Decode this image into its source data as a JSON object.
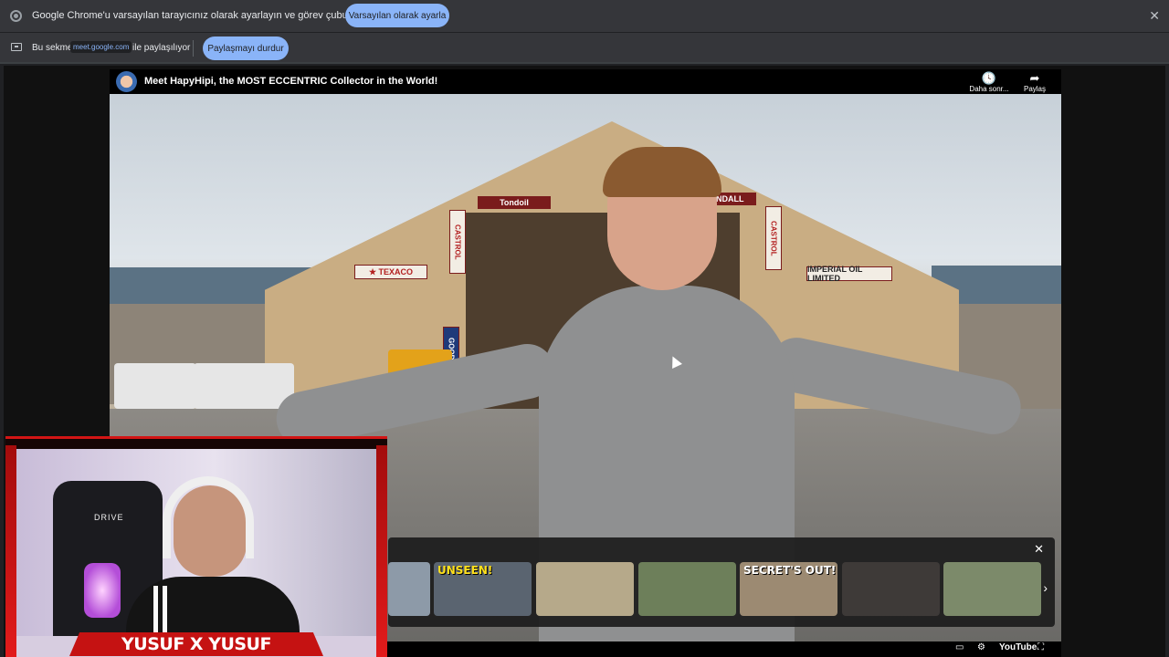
{
  "infobar": {
    "message": "Google Chrome'u varsayılan tarayıcınız olarak ayarlayın ve görev çubuğunuza sabitleyin",
    "default_button": "Varsayılan olarak ayarla",
    "close": "✕"
  },
  "sharebar": {
    "prefix": "Bu sekme",
    "host": "meet.google.com",
    "suffix": "ile paylaşılıyor",
    "stop_button": "Paylaşmayı durdur"
  },
  "video": {
    "title": "Meet HapyHipi, the MOST ECCENTRIC Collector in the World!",
    "watch_later_label": "Daha sonr...",
    "share_label": "Paylaş",
    "watch_later_icon": "clock-icon",
    "share_icon": "share-arrow-icon",
    "signs": {
      "texaco": "★ TEXACO",
      "imperial": "IMPERIAL OIL LIMITED",
      "castrol_l": "CASTROL",
      "castrol_r": "CASTROL",
      "tondoil": "Tondoil",
      "kendall": "KENDALL",
      "good": "GOOD RICH"
    }
  },
  "end_screen": {
    "close": "✕",
    "thumbnails": [
      {
        "caption": "",
        "bg": "#8d9aa8"
      },
      {
        "caption": "UNSEEN!",
        "bg": "#5a6470"
      },
      {
        "caption": "",
        "bg": "#b6a98a"
      },
      {
        "caption": "",
        "bg": "#6d7f5a"
      },
      {
        "caption": "SECRET'S OUT!",
        "bg": "#9c8a72"
      },
      {
        "caption": "",
        "bg": "#3e3a38"
      },
      {
        "caption": "",
        "bg": "#7c8a6a"
      }
    ],
    "next": "›"
  },
  "bottom_controls": {
    "youtube_label": "YouTube",
    "subtitles_icon": "▭",
    "settings_icon": "⚙",
    "fullscreen_icon": "⛶"
  },
  "webcam": {
    "name": "YUSUF X YUSUF",
    "chair_brand": "DRIVE"
  },
  "colors": {
    "chrome_bar": "#35363a",
    "pill": "#8ab4f8",
    "frame_red": "#c51212"
  }
}
